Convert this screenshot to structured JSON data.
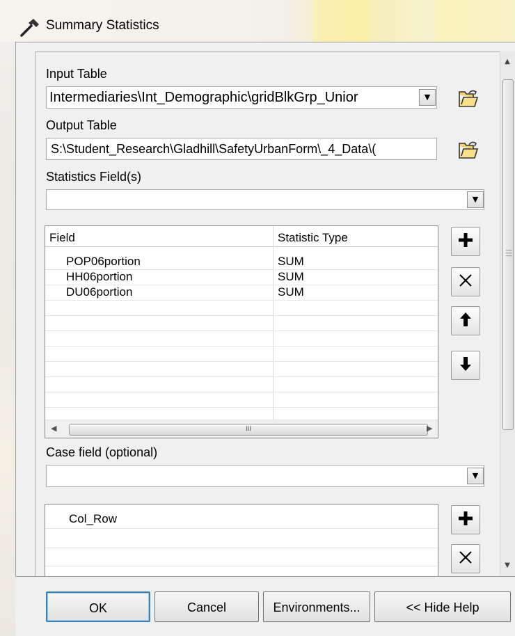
{
  "window": {
    "title": "Summary Statistics",
    "icon": "hammer-icon"
  },
  "form": {
    "input_table": {
      "label": "Input Table",
      "value": "Intermediaries\\Int_Demographic\\gridBlkGrp_Unior"
    },
    "output_table": {
      "label": "Output Table",
      "value": "S:\\Student_Research\\Gladhill\\SafetyUrbanForm\\_4_Data\\("
    },
    "statistics_fields": {
      "label": "Statistics Field(s)",
      "value": "",
      "columns": [
        "Field",
        "Statistic Type"
      ],
      "rows": [
        {
          "field": "POP06portion",
          "statistic": "SUM"
        },
        {
          "field": "HH06portion",
          "statistic": "SUM"
        },
        {
          "field": "DU06portion",
          "statistic": "SUM"
        }
      ],
      "hscroll_grip": "III"
    },
    "case_field": {
      "label": "Case field (optional)",
      "value": "",
      "items": [
        "Col_Row"
      ]
    }
  },
  "buttons": {
    "ok": "OK",
    "cancel": "Cancel",
    "environments": "Environments...",
    "hide_help": "<< Hide Help"
  },
  "icons": {
    "browse": "open-folder-icon",
    "add": "plus-icon",
    "delete": "x-icon",
    "up": "up-arrow-icon",
    "down": "down-arrow-icon"
  },
  "colors": {
    "ok_border": "#3c7fb1",
    "title_glow": "#fbf19f"
  }
}
